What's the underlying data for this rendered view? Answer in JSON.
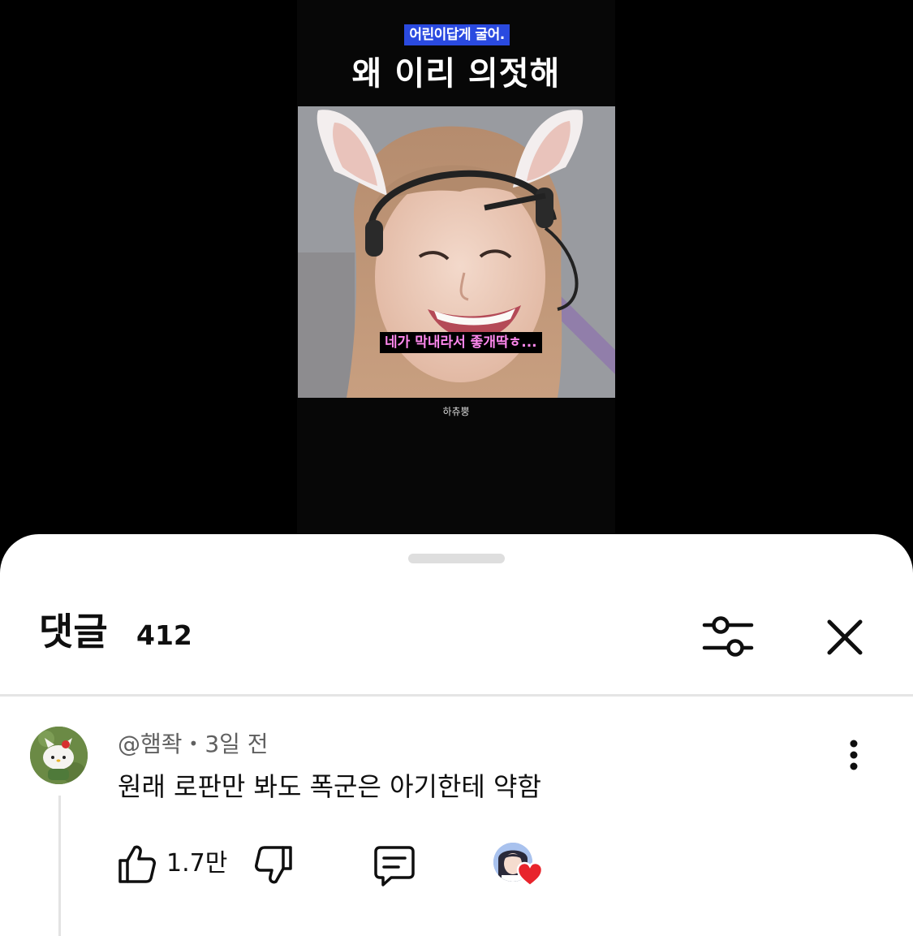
{
  "video": {
    "caption_top": "어린이답게 굴어.",
    "title": "왜 이리 의젓해",
    "thumb_caption": "네가 막내라서 좋개딱ㅎ...",
    "channel_watermark": "하츄뿡"
  },
  "comments_panel": {
    "title": "댓글",
    "count": "412",
    "comments": [
      {
        "author": "@햄좍",
        "time": "3일 전",
        "separator": "•",
        "text": "원래 로판만 봐도 폭군은 아기한테 약함",
        "likes": "1.7만",
        "creator_hearted": true
      }
    ]
  },
  "colors": {
    "caption_bg": "#2a4ae0",
    "thumb_caption_text": "#ff88ee",
    "heart": "#e8242c",
    "divider": "#e5e5e5"
  },
  "icons": {
    "filter": "sliders-icon",
    "close": "close-icon",
    "more": "more-vertical-icon",
    "like": "thumbs-up-icon",
    "dislike": "thumbs-down-icon",
    "reply": "comment-icon",
    "heart": "heart-icon"
  }
}
